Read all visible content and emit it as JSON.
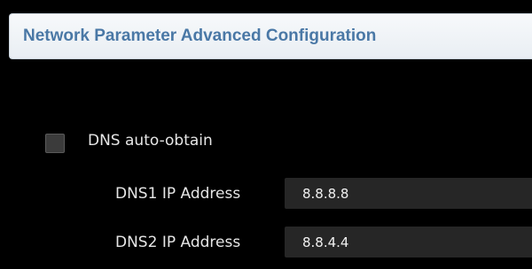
{
  "header": {
    "title": "Network Parameter Advanced Configuration"
  },
  "dns_auto": {
    "label": "DNS auto-obtain",
    "checked": false
  },
  "dns1": {
    "label": "DNS1 IP Address",
    "value": "8.8.8.8"
  },
  "dns2": {
    "label": "DNS2 IP Address",
    "value": "8.8.4.4"
  },
  "colors": {
    "panel_background": "#000000",
    "header_title": "#4a78a6",
    "input_background": "#262626",
    "label_text": "#e6e6e6"
  }
}
